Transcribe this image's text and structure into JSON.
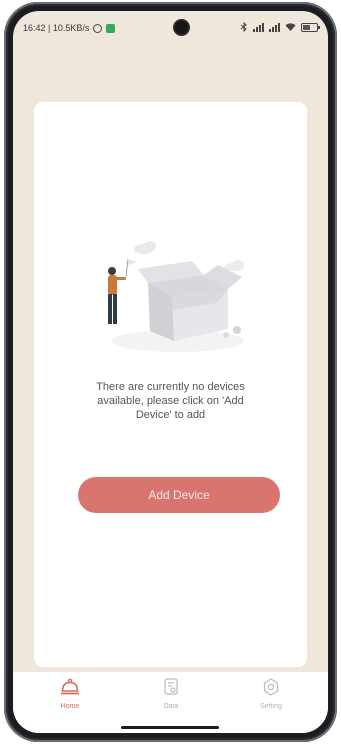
{
  "status": {
    "time_and_speed": "16:42 | 10.5KB/s"
  },
  "empty_state": {
    "message_line1": "There are currently no devices",
    "message_line2": "available, please click on 'Add",
    "message_line3": "Device' to add"
  },
  "actions": {
    "add_device_label": "Add Device"
  },
  "nav": {
    "items": [
      {
        "label": "Home",
        "icon": "home-bell-icon",
        "active": true
      },
      {
        "label": "Data",
        "icon": "data-report-icon",
        "active": false
      },
      {
        "label": "Setting",
        "icon": "gear-icon",
        "active": false
      }
    ]
  },
  "colors": {
    "accent": "#d9756f",
    "screen_bg": "#efe6dc",
    "card_bg": "#ffffff"
  }
}
